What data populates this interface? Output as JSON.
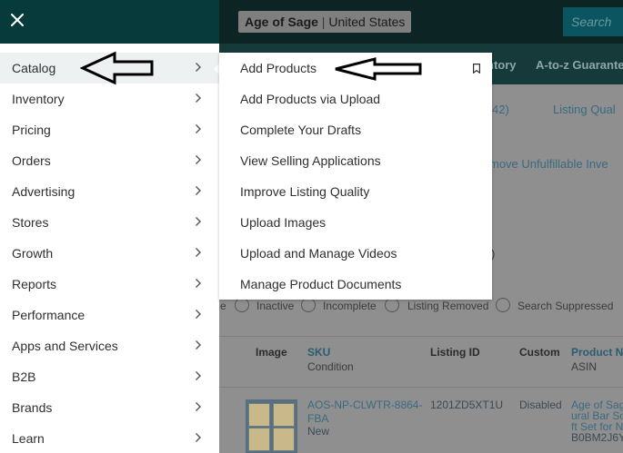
{
  "header": {
    "close_icon": "close-icon",
    "store_name": "Age of Sage",
    "store_separator": "|",
    "store_region": "United States",
    "search_button": "Search"
  },
  "background": {
    "nav_items": [
      "ntory",
      "A-to-z Guarantee"
    ],
    "row1": [
      "42)",
      "Listing Qual"
    ],
    "remove_text": "move Unfulfillable Inve",
    "paren": ")",
    "filters": [
      "Inactive",
      "Incomplete",
      "Listing Removed",
      "Search Suppressed"
    ],
    "filter_fragment": "e",
    "table_headers": {
      "image": "Image",
      "sku": "SKU",
      "sku_sub": "Condition",
      "listing_id": "Listing ID",
      "custom": "Custom",
      "product": "Product N",
      "product_sub": "ASIN"
    },
    "row": {
      "sku_line1": "AOS-NP-CLWTR-8864-",
      "sku_line2": "FBA",
      "condition": "New",
      "listing_id": "1201ZD5XT1U",
      "custom": "Disabled",
      "product_line1": "Age of Sag",
      "product_line2": "ural Bar So",
      "product_line3": "ft Set for N",
      "product_line4": "B0BM2J6Y"
    }
  },
  "drawer": {
    "items": [
      {
        "label": "Catalog"
      },
      {
        "label": "Inventory"
      },
      {
        "label": "Pricing"
      },
      {
        "label": "Orders"
      },
      {
        "label": "Advertising"
      },
      {
        "label": "Stores"
      },
      {
        "label": "Growth"
      },
      {
        "label": "Reports"
      },
      {
        "label": "Performance"
      },
      {
        "label": "Apps and Services"
      },
      {
        "label": "B2B"
      },
      {
        "label": "Brands"
      },
      {
        "label": "Learn"
      }
    ]
  },
  "submenu": {
    "items": [
      {
        "label": "Add Products"
      },
      {
        "label": "Add Products via Upload"
      },
      {
        "label": "Complete Your Drafts"
      },
      {
        "label": "View Selling Applications"
      },
      {
        "label": "Improve Listing Quality"
      },
      {
        "label": "Upload Images"
      },
      {
        "label": "Upload and Manage Videos"
      },
      {
        "label": "Manage Product Documents"
      }
    ],
    "bookmark_icon": "bookmark-icon"
  },
  "colors": {
    "topbar": "#073a3a",
    "drawer_bg": "#ffffff",
    "active_item_bg": "#eef1f1",
    "text": "#2f2f2f"
  }
}
